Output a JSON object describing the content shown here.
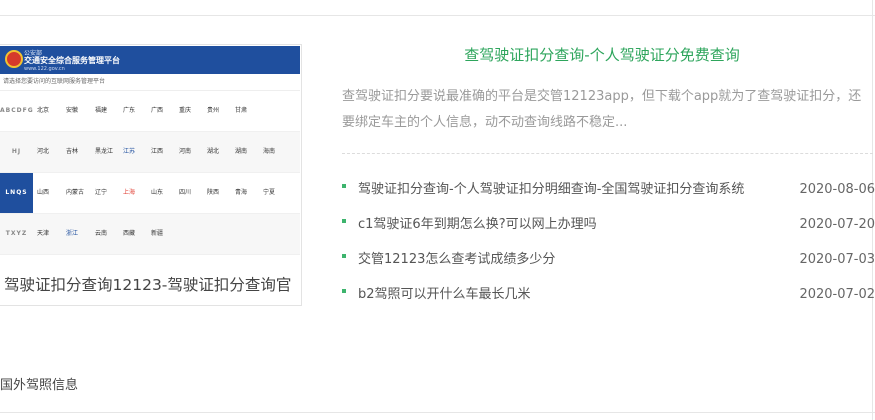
{
  "featured": {
    "caption": "驾驶证扣分查询12123-驾驶证扣分查询官",
    "thumbnail": {
      "site_small": "公安部",
      "site_title": "交通安全综合服务管理平台",
      "site_url": "www.122.gov.cn",
      "subtitle": "请选择您要访问的互联网服务管理平台",
      "rows": [
        {
          "letters": "ABCDFG",
          "provinces": [
            "北京",
            "安徽",
            "福建",
            "广东",
            "广西",
            "重庆",
            "贵州",
            "甘肃"
          ]
        },
        {
          "letters": "HJ",
          "provinces": [
            "河北",
            "吉林",
            "黑龙江",
            "江苏",
            "江西",
            "河南",
            "湖北",
            "湖南",
            "海南"
          ]
        },
        {
          "letters": "LNQS",
          "provinces": [
            "山西",
            "内蒙古",
            "辽宁",
            "上海",
            "山东",
            "四川",
            "陕西",
            "青海",
            "宁夏"
          ]
        },
        {
          "letters": "TXYZ",
          "provinces": [
            "天津",
            "浙江",
            "云南",
            "西藏",
            "新疆"
          ]
        }
      ]
    }
  },
  "article": {
    "headline": "查驾驶证扣分查询-个人驾驶证分免费查询",
    "summary": "查驾驶证扣分要说最准确的平台是交管12123app，但下载个app就为了查驾驶证扣分，还要绑定车主的个人信息，动不动查询线路不稳定..."
  },
  "related": [
    {
      "title": "驾驶证扣分查询-个人驾驶证扣分明细查询-全国驾驶证扣分查询系统",
      "date": "2020-08-06"
    },
    {
      "title": "c1驾驶证6年到期怎么换?可以网上办理吗",
      "date": "2020-07-20"
    },
    {
      "title": "交管12123怎么查考试成绩多少分",
      "date": "2020-07-03"
    },
    {
      "title": "b2驾照可以开什么车最长几米",
      "date": "2020-07-02"
    }
  ],
  "section": {
    "label": "国外驾照信息"
  },
  "colors": {
    "accent_green": "#2ea55c",
    "bullet_green": "#3db46d",
    "gov_blue": "#1f4f9e"
  }
}
